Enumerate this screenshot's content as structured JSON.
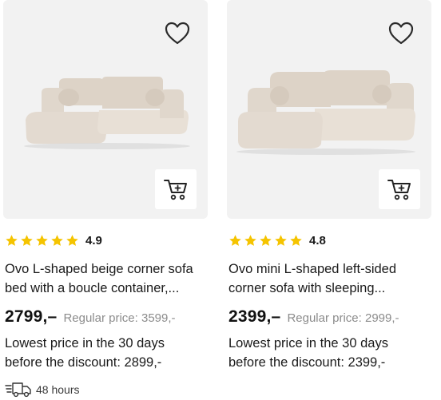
{
  "products": [
    {
      "rating": "4.9",
      "title_line1": "Ovo L-shaped beige corner sofa",
      "title_line2": "bed with a boucle container,...",
      "price": "2799,–",
      "regular_price": "Regular price: 3599,-",
      "lowest_line1": "Lowest price in the 30 days",
      "lowest_line2": "before the discount: 2899,-",
      "delivery": "48 hours",
      "icons": [
        "heart-outline-icon",
        "add-to-cart-icon",
        "truck-icon"
      ]
    },
    {
      "rating": "4.8",
      "title_line1": "Ovo mini L-shaped left-sided",
      "title_line2": "corner sofa with sleeping...",
      "price": "2399,–",
      "regular_price": "Regular price: 2999,-",
      "lowest_line1": "Lowest price in the 30 days",
      "lowest_line2": "before the discount: 2399,-",
      "icons": [
        "heart-outline-icon",
        "add-to-cart-icon"
      ]
    }
  ],
  "colors": {
    "star": "#f5c400",
    "image_bg": "#f2f2f2",
    "regular_price": "#8c8c8c",
    "sofa": "#e5ddd3"
  }
}
